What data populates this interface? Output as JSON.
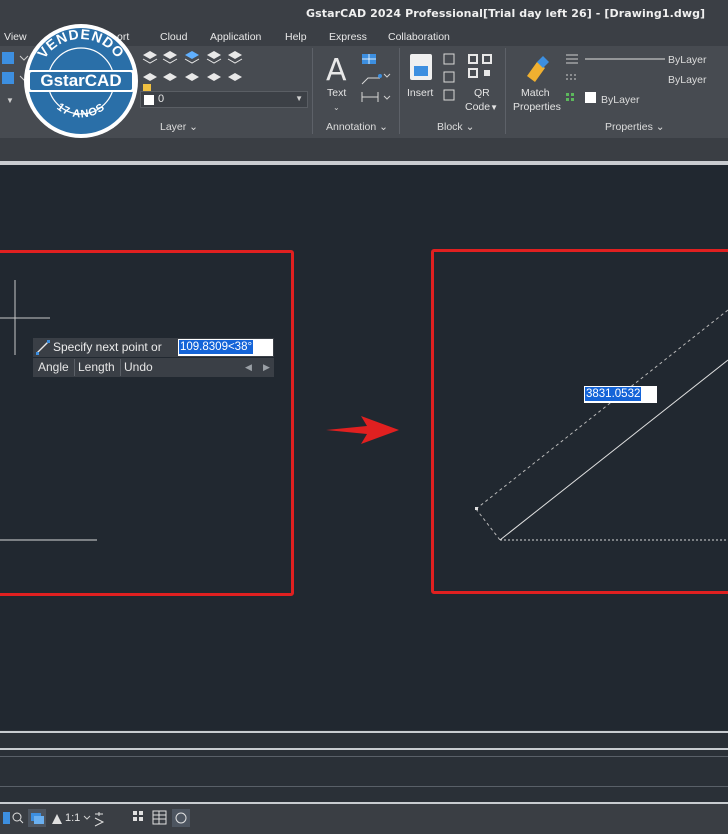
{
  "window": {
    "title": "GstarCAD 2024 Professional[Trial day left 26] - [Drawing1.dwg]"
  },
  "menu": {
    "items": [
      "View",
      "ort",
      "Cloud",
      "Application",
      "Help",
      "Express",
      "Collaboration"
    ]
  },
  "ribbon": {
    "layer_value": "0",
    "panels": {
      "layer": "Layer",
      "annotation": "Annotation",
      "block": "Block",
      "properties": "Properties"
    },
    "buttons": {
      "text": "Text",
      "insert": "Insert",
      "qr_line1": "QR",
      "qr_line2": "Code",
      "match_line1": "Match",
      "match_line2": "Properties"
    },
    "properties": {
      "color": "ByLayer",
      "linetype": "ByLayer",
      "lineweight": "ByLayer"
    }
  },
  "badge": {
    "top": "VENDENDO",
    "brand": "GstarCAD",
    "bottom": "17 ANOS",
    "color": "#2a6fa8"
  },
  "canvas": {
    "prompt_text": "Specify next point or",
    "prompt_value": "109.8309<38°",
    "options": [
      "Angle",
      "Length",
      "Undo"
    ],
    "dimension_value": "3831.0532"
  },
  "status": {
    "scale": "1:1"
  },
  "colors": {
    "frame": "#e02020",
    "arrow": "#e02020",
    "selection": "#1464d8",
    "background": "#212830"
  }
}
